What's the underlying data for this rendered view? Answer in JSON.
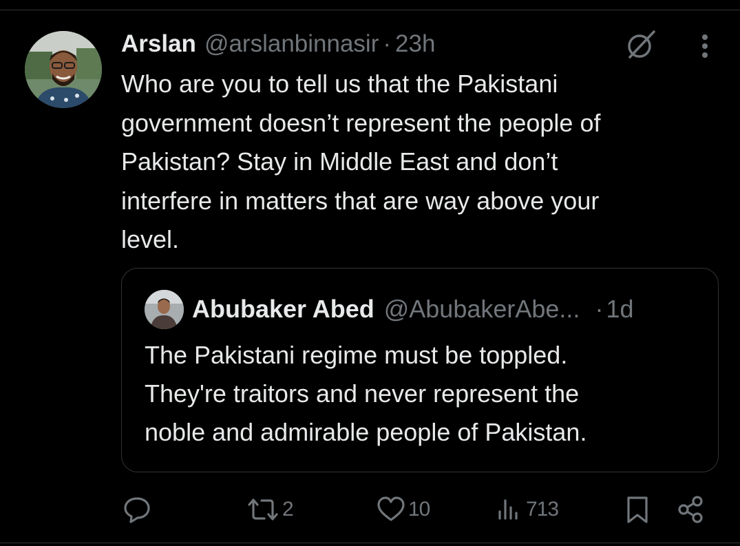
{
  "tweet": {
    "author": {
      "display_name": "Arslan",
      "handle": "@arslanbinnasir",
      "avatar_icon": "profile-photo"
    },
    "separator": "·",
    "time": "23h",
    "grok_icon": "grok-slash-icon",
    "more_icon": "vertical-ellipsis-icon",
    "text_lines": [
      "Who are you to tell us that the Pakistani",
      "government doesn’t represent the people of",
      "Pakistan? Stay in Middle East and don’t",
      "interfere in matters that are way above your",
      "level."
    ]
  },
  "quote": {
    "author": {
      "display_name": "Abubaker Abed",
      "handle": "@AbubakerAbe...",
      "avatar_icon": "profile-photo"
    },
    "separator": "·",
    "time": "1d",
    "text_lines": [
      "The Pakistani regime must be toppled.",
      "They're traitors and never represent the",
      "noble and admirable people of Pakistan."
    ]
  },
  "actions": {
    "reply": {
      "icon": "reply-icon",
      "count": ""
    },
    "repost": {
      "icon": "repost-icon",
      "count": "2"
    },
    "like": {
      "icon": "heart-icon",
      "count": "10"
    },
    "views": {
      "icon": "views-chart-icon",
      "count": "713"
    },
    "bookmark": {
      "icon": "bookmark-icon"
    },
    "share": {
      "icon": "share-icon"
    }
  },
  "colors": {
    "background": "#000000",
    "text_primary": "#e7e9ea",
    "text_secondary": "#71767b",
    "border": "#2f3336"
  }
}
